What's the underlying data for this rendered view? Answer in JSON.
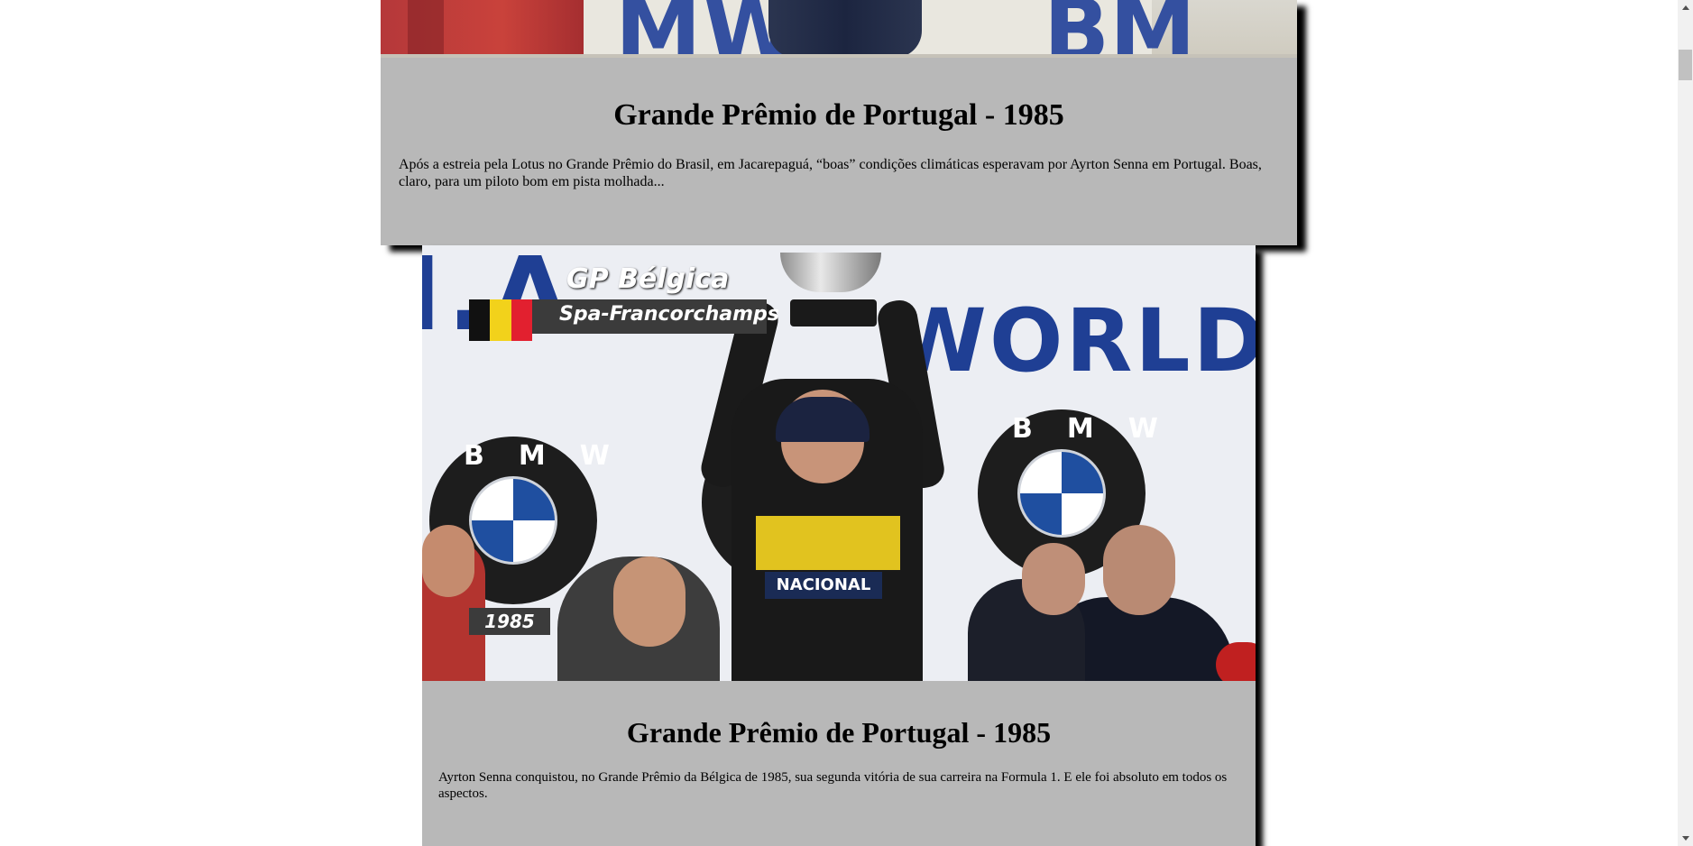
{
  "cards": [
    {
      "title": "Grande Prêmio de Portugal - 1985",
      "text": "Após a estreia pela Lotus no Grande Prêmio do Brasil, em Jacarepaguá, “boas” condições climáticas esperavam por Ayrton Senna em Portugal. Boas, claro, para um piloto bom em pista molhada...",
      "photo_text": "MWI BM"
    },
    {
      "title": "Grande Prêmio de Portugal - 1985",
      "text": "Ayrton Senna conquistou, no Grande Prêmio da Bélgica de 1985, sua segunda vitória de sua carreira na Formula 1. E ele foi absoluto em todos os aspectos.",
      "photo": {
        "banner_text_left": "I.A.",
        "banner_text_right": "WORLD C",
        "bmw_label": "BMW",
        "driver_band": "NACIONAL",
        "gp_title": "GP Bélgica",
        "gp_subtitle": "Spa-Francorchamps",
        "year": "1985",
        "flag_colors": [
          "#111111",
          "#f2d21b",
          "#e2202f"
        ]
      }
    }
  ],
  "colors": {
    "card_background": "#b8b8b8",
    "brand_blue": "#1f3f94"
  },
  "scrollbar": {
    "up_icon": "arrow-up-icon",
    "down_icon": "arrow-down-icon"
  }
}
